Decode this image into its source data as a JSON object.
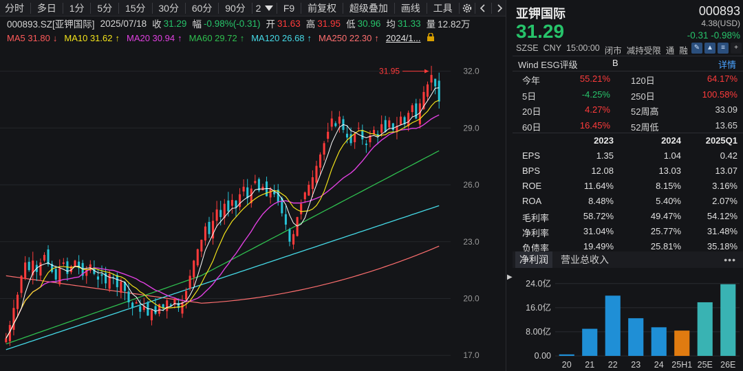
{
  "toolbar": {
    "items": [
      "分时",
      "多日",
      "1分",
      "5分",
      "15分",
      "30分",
      "60分",
      "90分",
      "2"
    ],
    "more_icon": "dropdown-triangle-icon",
    "f9": "F9",
    "adjust": "前复权",
    "overlay": "超级叠加",
    "draw": "画线",
    "tools": "工具",
    "settings_icon": "gear-icon",
    "prev_icon": "chevron-left-icon",
    "next_icon": "chevron-right-icon"
  },
  "info": {
    "code_name": "000893.SZ[亚钾国际]",
    "date": "2025/07/18",
    "close_label": "收",
    "close": "31.29",
    "amp_label": "幅",
    "amp": "-0.98%(-0.31)",
    "open_label": "开",
    "open": "31.63",
    "high_label": "高",
    "high": "31.95",
    "low_label": "低",
    "low": "30.96",
    "avg_label": "均",
    "avg": "31.33",
    "vol_label": "量",
    "vol": "12.82万"
  },
  "ma": {
    "ma5": {
      "label": "MA5 31.80",
      "arrow": "↓",
      "color": "#ff5a5a"
    },
    "ma10": {
      "label": "MA10 31.62",
      "arrow": "↑",
      "color": "#f2e21a"
    },
    "ma20": {
      "label": "MA20 30.94",
      "arrow": "↑",
      "color": "#e040e0"
    },
    "ma60": {
      "label": "MA60 29.72",
      "arrow": "↑",
      "color": "#2fbf4f"
    },
    "ma120": {
      "label": "MA120 26.68",
      "arrow": "↑",
      "color": "#45d9e6"
    },
    "ma250": {
      "label": "MA250 22.30",
      "arrow": "↑",
      "color": "#ff6f6f"
    },
    "range": "2024/1..."
  },
  "chart_data": {
    "type": "candlestick",
    "y_ticks": [
      "32.0",
      "29.0",
      "26.0",
      "23.0",
      "20.0",
      "17.0"
    ],
    "ylim": [
      16.5,
      33.0
    ],
    "max_marker": "31.95",
    "colors": {
      "up": "#ff3b3b",
      "down": "#27c3d6",
      "ma5": "#ffffff",
      "ma10": "#f2e21a",
      "ma20": "#e040e0",
      "ma60": "#2fbf4f",
      "ma120": "#45d9e6",
      "ma250": "#ff6f6f"
    },
    "close_path": [
      17.9,
      18.6,
      19.5,
      20.2,
      21.2,
      21.9,
      21.5,
      22.0,
      21.4,
      21.9,
      22.3,
      21.8,
      21.4,
      21.0,
      21.6,
      21.9,
      21.3,
      21.7,
      22.0,
      21.6,
      21.2,
      21.5,
      21.8,
      21.3,
      21.0,
      21.2,
      20.8,
      21.3,
      21.1,
      20.6,
      20.9,
      20.4,
      19.8,
      19.5,
      19.8,
      19.3,
      19.6,
      19.1,
      19.4,
      19.2,
      19.7,
      19.5,
      19.9,
      19.6,
      20.0,
      19.5,
      19.8,
      20.4,
      21.2,
      22.0,
      22.6,
      23.1,
      23.8,
      23.4,
      24.1,
      24.7,
      24.3,
      25.0,
      24.6,
      25.2,
      24.8,
      25.5,
      25.9,
      25.3,
      25.8,
      26.2,
      25.7,
      25.9,
      25.4,
      25.8,
      25.5,
      25.1,
      24.5,
      23.9,
      23.0,
      23.4,
      24.3,
      25.0,
      25.6,
      26.0,
      26.4,
      27.0,
      27.6,
      28.2,
      28.8,
      29.5,
      29.1,
      29.6,
      28.9,
      28.5,
      28.2,
      28.7,
      29.0,
      28.4,
      28.1,
      28.6,
      28.9,
      28.6,
      29.2,
      28.8,
      29.4,
      28.9,
      29.1,
      29.6,
      29.2,
      29.8,
      30.2,
      29.5,
      30.3,
      30.9,
      31.3,
      31.8,
      31.2,
      30.4
    ]
  },
  "panel": {
    "name": "亚钾国际",
    "code": "000893",
    "price": "31.29",
    "usd": "4.38(USD)",
    "change": "-0.31  -0.98%",
    "meta": [
      "SZSE",
      "CNY",
      "15:00:00",
      "闭市",
      "减持受限",
      "通",
      "融"
    ],
    "icons": [
      "pencil-icon",
      "chart-icon",
      "list-icon",
      "plus-icon"
    ],
    "esg_label": "Wind ESG评级",
    "esg_value": "B",
    "esg_more": "详情",
    "perf": [
      {
        "l1": "今年",
        "v1": "55.21%",
        "c1": "r",
        "l2": "120日",
        "v2": "64.17%",
        "c2": "r"
      },
      {
        "l1": "5日",
        "v1": "-4.25%",
        "c1": "g",
        "l2": "250日",
        "v2": "100.58%",
        "c2": "r"
      },
      {
        "l1": "20日",
        "v1": "4.27%",
        "c1": "r",
        "l2": "52周高",
        "v2": "33.09",
        "c2": "w"
      },
      {
        "l1": "60日",
        "v1": "16.45%",
        "c1": "r",
        "l2": "52周低",
        "v2": "13.65",
        "c2": "w"
      }
    ],
    "fin_head": [
      "",
      "2023",
      "2024",
      "2025Q1"
    ],
    "fin": [
      [
        "EPS",
        "1.35",
        "1.04",
        "0.42"
      ],
      [
        "BPS",
        "12.08",
        "13.03",
        "13.07"
      ],
      [
        "ROE",
        "11.64%",
        "8.15%",
        "3.16%"
      ],
      [
        "ROA",
        "8.48%",
        "5.40%",
        "2.07%"
      ],
      [
        "毛利率",
        "58.72%",
        "49.47%",
        "54.12%"
      ],
      [
        "净利率",
        "31.04%",
        "25.77%",
        "31.48%"
      ],
      [
        "负债率",
        "19.49%",
        "25.81%",
        "35.18%"
      ]
    ],
    "tab1": "净利润",
    "tab2": "营业总收入",
    "tab_more": "•••"
  },
  "bar_chart": {
    "type": "bar",
    "categories": [
      "20",
      "21",
      "22",
      "23",
      "24",
      "25H1",
      "25E",
      "26E"
    ],
    "values": [
      0.5,
      9.0,
      20.0,
      12.5,
      9.5,
      8.4,
      17.8,
      23.8
    ],
    "colors": [
      "#1f8fd6",
      "#1f8fd6",
      "#1f8fd6",
      "#1f8fd6",
      "#1f8fd6",
      "#e07b10",
      "#39b3b3",
      "#39b3b3"
    ],
    "y_ticks": [
      "24.0亿",
      "16.0亿",
      "8.00亿",
      "0.00"
    ],
    "tick_values": [
      24,
      16,
      8,
      0
    ],
    "ylim": [
      0,
      26
    ]
  }
}
